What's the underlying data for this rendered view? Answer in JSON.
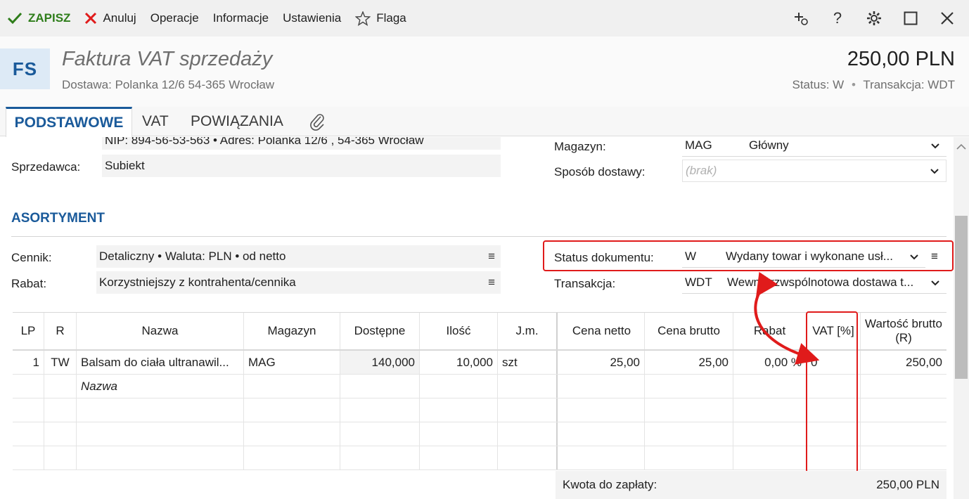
{
  "toolbar": {
    "save": "ZAPISZ",
    "cancel": "Anuluj",
    "operations": "Operacje",
    "info": "Informacje",
    "settings": "Ustawienia",
    "flag": "Flaga",
    "accent": "#2e7d1a",
    "cancel_color": "#e01b1b"
  },
  "header": {
    "badge": "FS",
    "title": "Faktura VAT sprzedaży",
    "delivery": "Dostawa: Polanka  12/6  54-365 Wrocław",
    "total": "250,00 PLN",
    "status_label": "Status:",
    "status_value": "W",
    "transaction_label": "Transakcja:",
    "transaction_value": "WDT"
  },
  "tabs": [
    "PODSTAWOWE",
    "VAT",
    "POWIĄZANIA"
  ],
  "seller": {
    "nip_line": "NIP:  894-56-53-563  •  Adres:  Polanka  12/6 , 54-365 Wrocław",
    "label": "Sprzedawca:",
    "value": "Subiekt"
  },
  "warehouse": {
    "label": "Magazyn:",
    "code": "MAG",
    "name": "Główny",
    "delivery_label": "Sposób dostawy:",
    "delivery_placeholder": "(brak)"
  },
  "assortment": {
    "title": "ASORTYMENT",
    "pricelist_label": "Cennik:",
    "pricelist_value": "Detaliczny • Waluta: PLN • od netto",
    "discount_label": "Rabat:",
    "discount_value": "Korzystniejszy z kontrahenta/cennika",
    "doc_status_label": "Status dokumentu:",
    "doc_status_code": "W",
    "doc_status_name": "Wydany towar i wykonane usł...",
    "transaction_label": "Transakcja:",
    "transaction_code": "WDT",
    "transaction_name": "Wewnątrzwspólnotowa dostawa t..."
  },
  "grid": {
    "columns": [
      "LP",
      "R",
      "Nazwa",
      "Magazyn",
      "Dostępne",
      "Ilość",
      "J.m.",
      "Cena netto",
      "Cena brutto",
      "Rabat",
      "VAT [%]",
      "Wartość brutto (R)"
    ],
    "rows": [
      [
        "1",
        "TW",
        "Balsam do ciała ultranawil...",
        "MAG",
        "140,000",
        "10,000",
        "szt",
        "25,00",
        "25,00",
        "0,00 %",
        "0",
        "250,00"
      ]
    ],
    "new_row_placeholder": "Nazwa"
  },
  "summary": {
    "label": "Kwota do zapłaty:",
    "value": "250,00 PLN"
  },
  "annotation_color": "#e01b1b",
  "brand_color": "#1a5a9a"
}
